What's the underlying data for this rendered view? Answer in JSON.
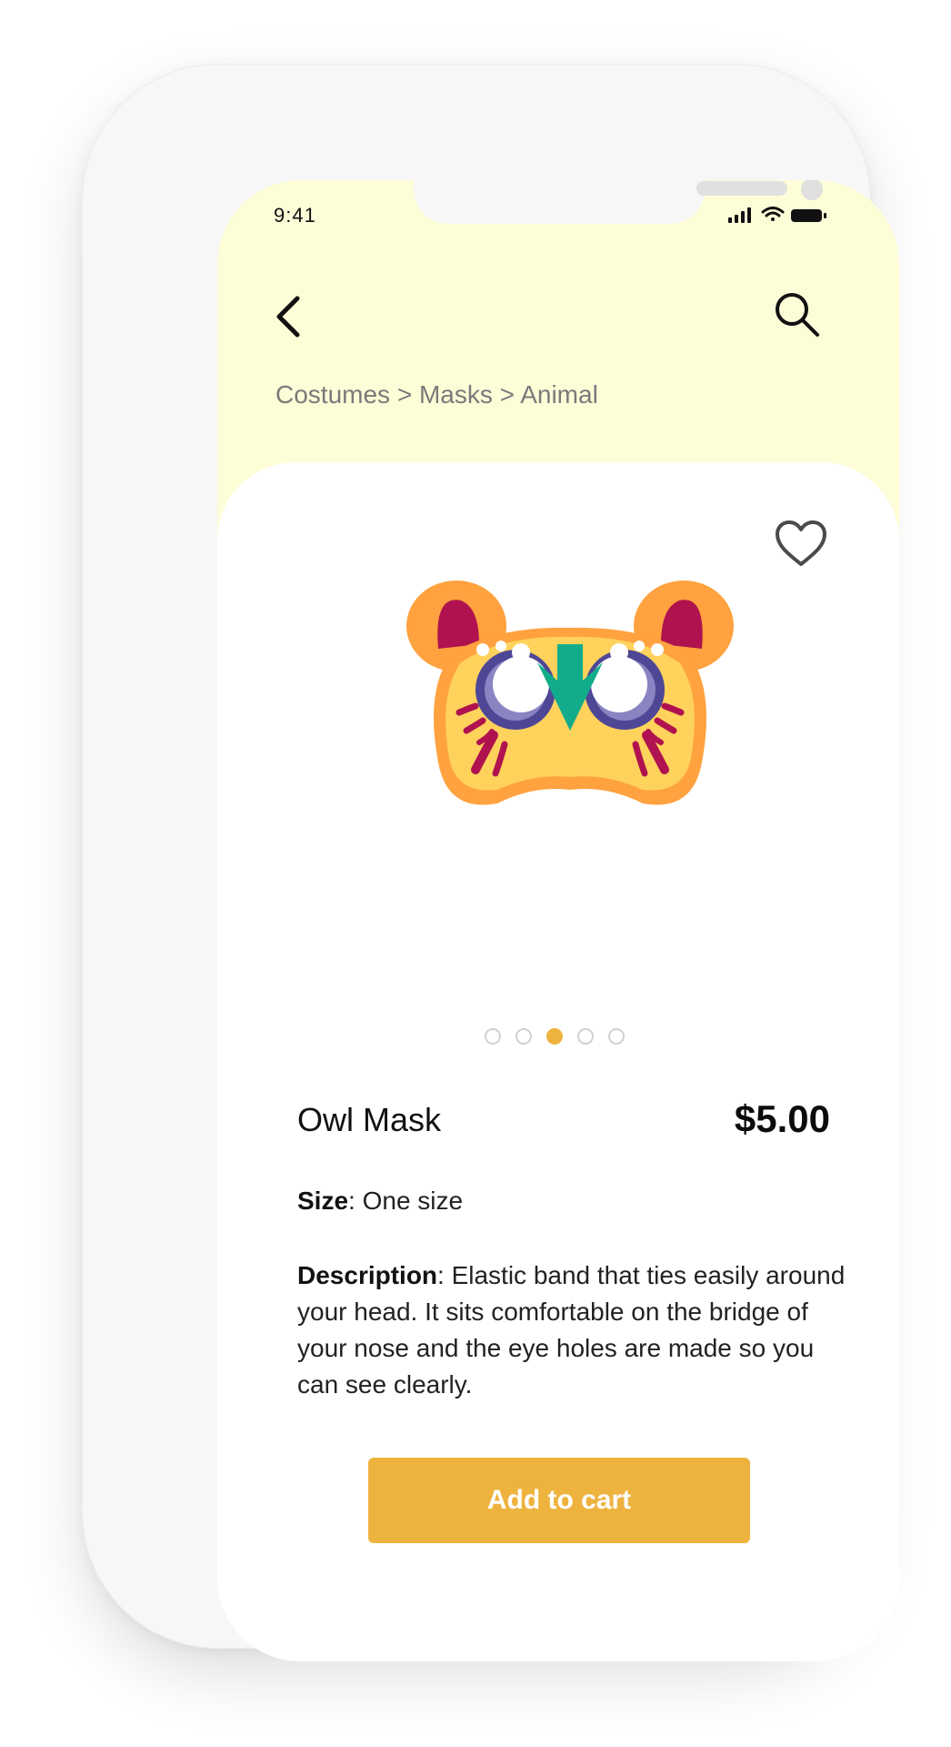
{
  "status_bar": {
    "time": "9:41"
  },
  "header": {
    "back_icon": "chevron-left-icon",
    "search_icon": "search-icon",
    "breadcrumb": "Costumes > Masks > Animal"
  },
  "product": {
    "favorite_icon": "heart-outline-icon",
    "image_description_name": "owl-mask-image",
    "carousel": {
      "count": 5,
      "active_index": 2
    },
    "name": "Owl Mask",
    "price": "$5.00",
    "size_label": "Size",
    "size_value": ": One size",
    "description_label": "Description",
    "description_text": ": Elastic band that ties easily around your head. It sits comfortable on the bridge of your nose and the eye holes are made so you can see clearly.",
    "add_to_cart": "Add to cart"
  },
  "colors": {
    "header_bg": "#fdfdd8",
    "accent": "#eeb33f",
    "mask_yellow": "#ffd25c",
    "mask_orange": "#ffa23f",
    "mask_magenta": "#b0124f",
    "mask_green": "#12ac8a",
    "mask_purple": "#4e4796"
  }
}
